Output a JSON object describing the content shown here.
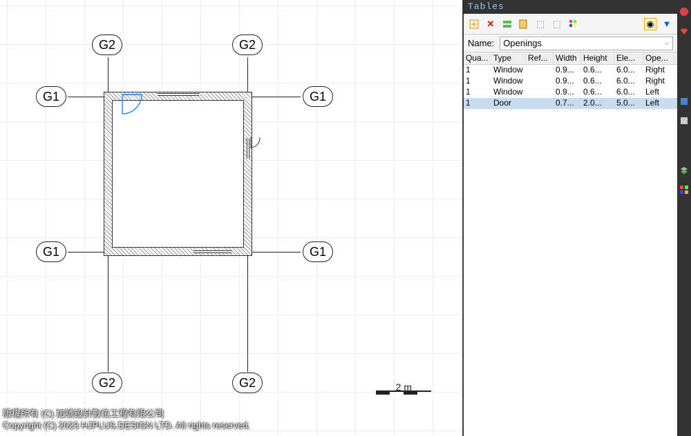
{
  "panel": {
    "title": "Tables",
    "name_label": "Name:",
    "name_value": "Openings"
  },
  "axes": {
    "g1": "G1",
    "g2": "G2"
  },
  "scale": "2 m",
  "columns": [
    "Qua...",
    "Type",
    "Ref...",
    "Width",
    "Height",
    "Ele...",
    "Ope..."
  ],
  "rows": [
    {
      "qua": "1",
      "type": "Window",
      "ref": "",
      "width": "0.9...",
      "height": "0.6...",
      "ele": "6.0...",
      "ope": "Right"
    },
    {
      "qua": "1",
      "type": "Window",
      "ref": "",
      "width": "0.9...",
      "height": "0.6...",
      "ele": "6.0...",
      "ope": "Right"
    },
    {
      "qua": "1",
      "type": "Window",
      "ref": "",
      "width": "0.9...",
      "height": "0.6...",
      "ele": "6.0...",
      "ope": "Left"
    },
    {
      "qua": "1",
      "type": "Door",
      "ref": "",
      "width": "0.7...",
      "height": "2.0...",
      "ele": "5.0...",
      "ope": "Left",
      "selected": true
    }
  ],
  "watermark": {
    "line1": "版權所有 (C) 加號設計數位工程有限公司",
    "line2": "Copyright (C) 2023 HJPLUS.DESIGN LTD. All rights reserved."
  },
  "toolbar_icons": [
    "add",
    "delete",
    "insert",
    "edit",
    "move-up",
    "move-down",
    "colorize",
    "highlight",
    "filter"
  ]
}
